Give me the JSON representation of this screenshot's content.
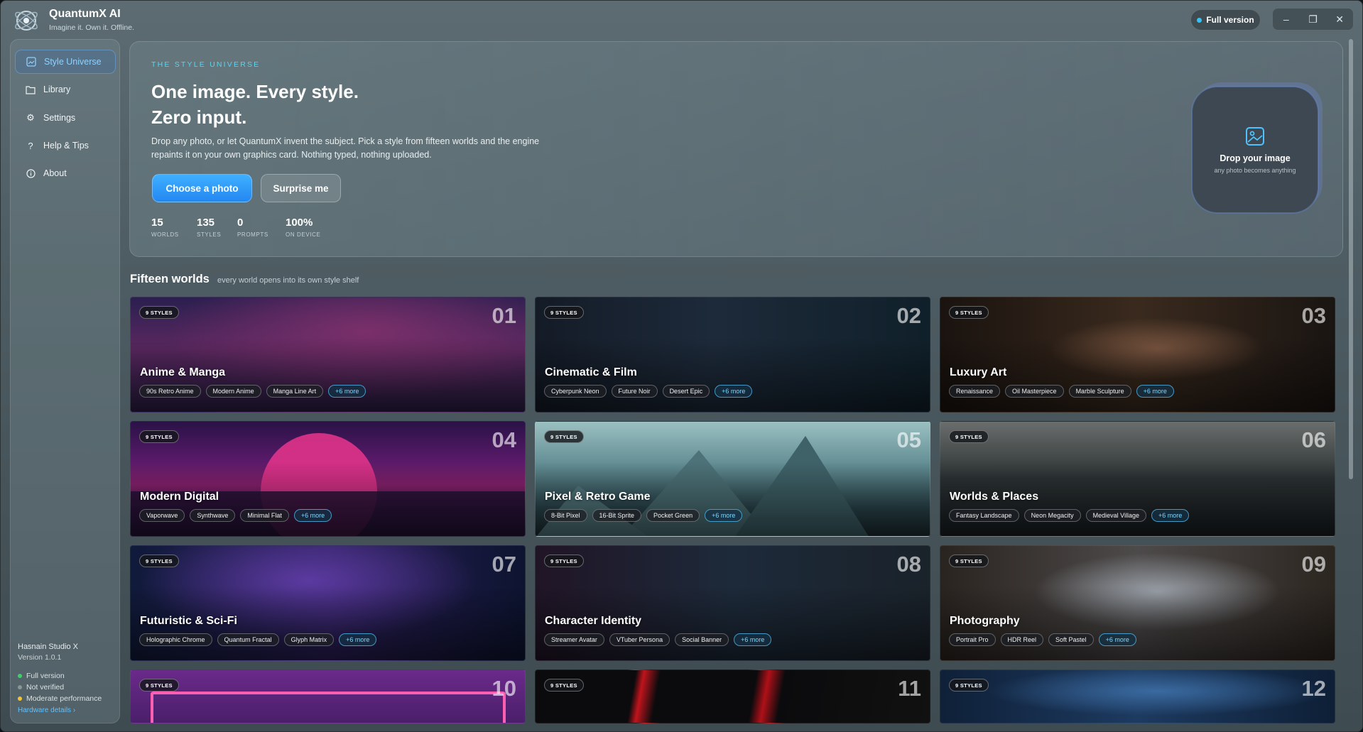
{
  "app": {
    "title": "QuantumX AI",
    "tagline": "Imagine it. Own it. Offline.",
    "full_version_label": "Full version",
    "window_controls": {
      "minimize": "–",
      "restore": "❐",
      "close": "✕"
    }
  },
  "sidebar": {
    "items": [
      {
        "label": "Style Universe",
        "icon": "image-icon",
        "active": true
      },
      {
        "label": "Library",
        "icon": "folder-icon",
        "active": false
      },
      {
        "label": "Settings",
        "icon": "gear-icon",
        "active": false
      },
      {
        "label": "Help & Tips",
        "icon": "question-icon",
        "active": false
      },
      {
        "label": "About",
        "icon": "info-icon",
        "active": false
      }
    ],
    "footer": {
      "studio": "Hasnain Studio X",
      "version": "Version 1.0.1",
      "statuses": [
        {
          "label": "Full version",
          "color": "#3ecf6a"
        },
        {
          "label": "Not verified",
          "color": "#8a9598"
        },
        {
          "label": "Moderate performance",
          "color": "#f2c23a"
        }
      ],
      "hardware_link": "Hardware details ›"
    }
  },
  "hero": {
    "eyebrow": "THE STYLE UNIVERSE",
    "headline_1": "One image. Every style.",
    "headline_2": "Zero input.",
    "description": "Drop any photo, or let QuantumX invent the subject. Pick a style from fifteen worlds and the engine repaints it on your own graphics card. Nothing typed, nothing uploaded.",
    "primary_button": "Choose a photo",
    "secondary_button": "Surprise me",
    "stats": [
      {
        "value": "15",
        "label": "WORLDS"
      },
      {
        "value": "135",
        "label": "STYLES"
      },
      {
        "value": "0",
        "label": "PROMPTS"
      },
      {
        "value": "100%",
        "label": "ON DEVICE"
      }
    ],
    "dropzone": {
      "title": "Drop your image",
      "subtitle": "any photo becomes anything"
    }
  },
  "worlds": {
    "title": "Fifteen worlds",
    "subtitle": "every world opens into its own style shelf",
    "cards": [
      {
        "num": "01",
        "badge": "9 STYLES",
        "title": "Anime & Manga",
        "chips": [
          "90s Retro Anime",
          "Modern Anime",
          "Manga Line Art"
        ],
        "more": "+6 more"
      },
      {
        "num": "02",
        "badge": "9 STYLES",
        "title": "Cinematic & Film",
        "chips": [
          "Cyberpunk Neon",
          "Future Noir",
          "Desert Epic"
        ],
        "more": "+6 more"
      },
      {
        "num": "03",
        "badge": "9 STYLES",
        "title": "Luxury Art",
        "chips": [
          "Renaissance",
          "Oil Masterpiece",
          "Marble Sculpture"
        ],
        "more": "+6 more"
      },
      {
        "num": "04",
        "badge": "9 STYLES",
        "title": "Modern Digital",
        "chips": [
          "Vaporwave",
          "Synthwave",
          "Minimal Flat"
        ],
        "more": "+6 more"
      },
      {
        "num": "05",
        "badge": "9 STYLES",
        "title": "Pixel & Retro Game",
        "chips": [
          "8-Bit Pixel",
          "16-Bit Sprite",
          "Pocket Green"
        ],
        "more": "+6 more"
      },
      {
        "num": "06",
        "badge": "9 STYLES",
        "title": "Worlds & Places",
        "chips": [
          "Fantasy Landscape",
          "Neon Megacity",
          "Medieval Village"
        ],
        "more": "+6 more"
      },
      {
        "num": "07",
        "badge": "9 STYLES",
        "title": "Futuristic & Sci-Fi",
        "chips": [
          "Holographic Chrome",
          "Quantum Fractal",
          "Glyph Matrix"
        ],
        "more": "+6 more"
      },
      {
        "num": "08",
        "badge": "9 STYLES",
        "title": "Character Identity",
        "chips": [
          "Streamer Avatar",
          "VTuber Persona",
          "Social Banner"
        ],
        "more": "+6 more"
      },
      {
        "num": "09",
        "badge": "9 STYLES",
        "title": "Photography",
        "chips": [
          "Portrait Pro",
          "HDR Reel",
          "Soft Pastel"
        ],
        "more": "+6 more"
      },
      {
        "num": "10",
        "badge": "9 STYLES"
      },
      {
        "num": "11",
        "badge": "9 STYLES"
      },
      {
        "num": "12",
        "badge": "9 STYLES"
      }
    ]
  }
}
